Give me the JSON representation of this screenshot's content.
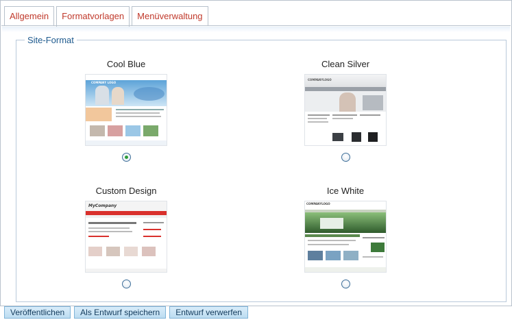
{
  "tabs": [
    {
      "label": "Allgemein"
    },
    {
      "label": "Formatvorlagen"
    },
    {
      "label": "Menüverwaltung"
    }
  ],
  "active_tab": "Formatvorlagen",
  "fieldset": {
    "legend": "Site-Format"
  },
  "options": [
    {
      "title": "Cool Blue",
      "selected": true,
      "accent": "#2f7fc1",
      "thumb_text": "COMPANY LOGO"
    },
    {
      "title": "Clean Silver",
      "selected": false,
      "accent": "#8a8f96",
      "thumb_text": "COMPANYLOGO"
    },
    {
      "title": "Custom Design",
      "selected": false,
      "accent": "#d9302c",
      "thumb_text": "MyCompany"
    },
    {
      "title": "Ice White",
      "selected": false,
      "accent": "#3d7a3a",
      "thumb_text": "COMPANYLOGO"
    }
  ],
  "buttons": {
    "publish": "Veröffentlichen",
    "save_draft": "Als Entwurf speichern",
    "discard_draft": "Entwurf verwerfen"
  }
}
